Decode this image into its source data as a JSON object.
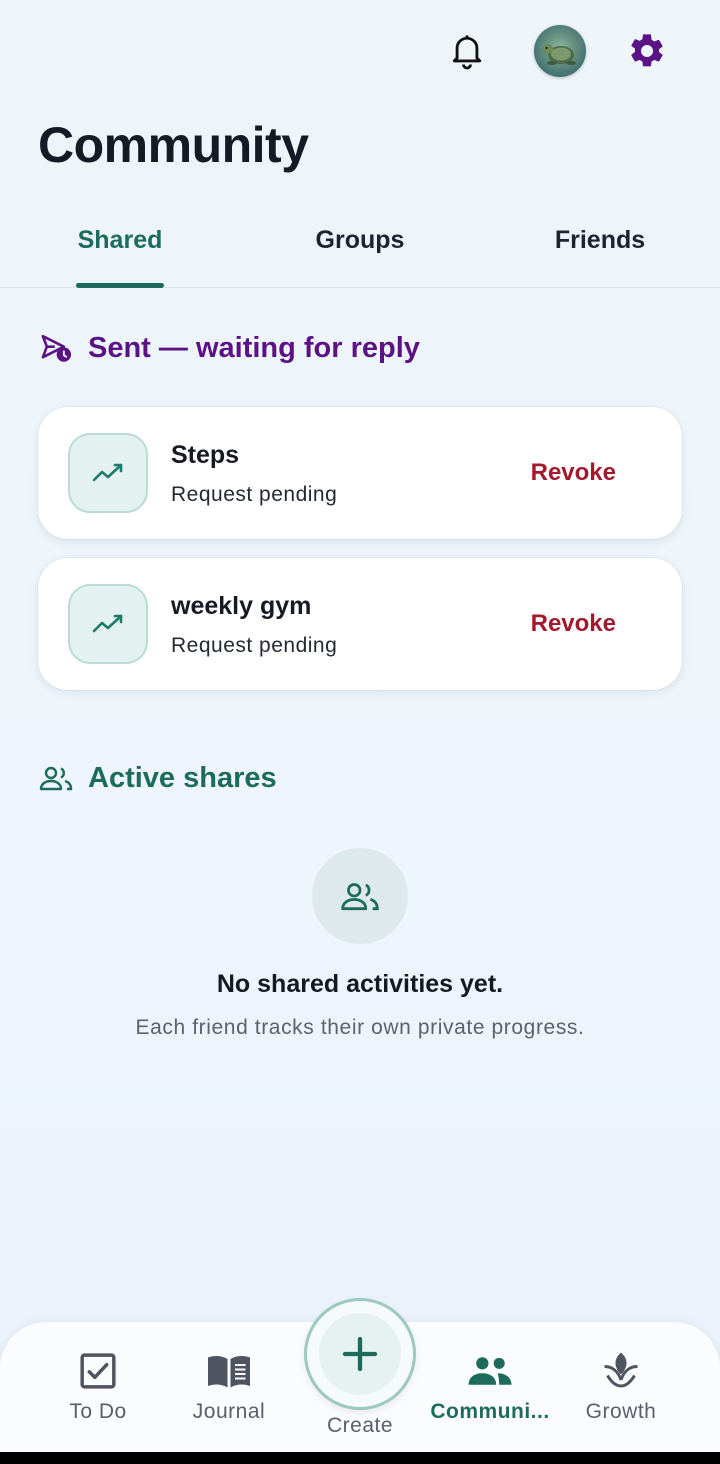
{
  "header": {
    "title": "Community",
    "icons": {
      "notifications": "bell-icon",
      "avatar": "turtle-avatar",
      "settings": "gear-icon"
    }
  },
  "tabs": [
    {
      "label": "Shared",
      "active": true
    },
    {
      "label": "Groups",
      "active": false
    },
    {
      "label": "Friends",
      "active": false
    }
  ],
  "sent_section": {
    "heading": "Sent — waiting for reply",
    "items": [
      {
        "title": "Steps",
        "status": "Request pending",
        "action": "Revoke",
        "icon": "trending-up-icon"
      },
      {
        "title": "weekly gym",
        "status": "Request pending",
        "action": "Revoke",
        "icon": "trending-up-icon"
      }
    ]
  },
  "active_section": {
    "heading": "Active shares",
    "empty_title": "No shared activities yet.",
    "empty_subtitle": "Each friend tracks their own private progress."
  },
  "bottom_nav": {
    "items": [
      {
        "label": "To Do",
        "icon": "checkbox-icon"
      },
      {
        "label": "Journal",
        "icon": "book-icon"
      },
      {
        "label": "Create",
        "icon": "plus-icon"
      },
      {
        "label": "Communi...",
        "icon": "people-icon",
        "active": true
      },
      {
        "label": "Growth",
        "icon": "sprout-icon"
      }
    ]
  },
  "colors": {
    "accent": "#1d6b5d",
    "sent_heading": "#5b1284",
    "revoke": "#a11a2e",
    "settings": "#5b1284"
  }
}
